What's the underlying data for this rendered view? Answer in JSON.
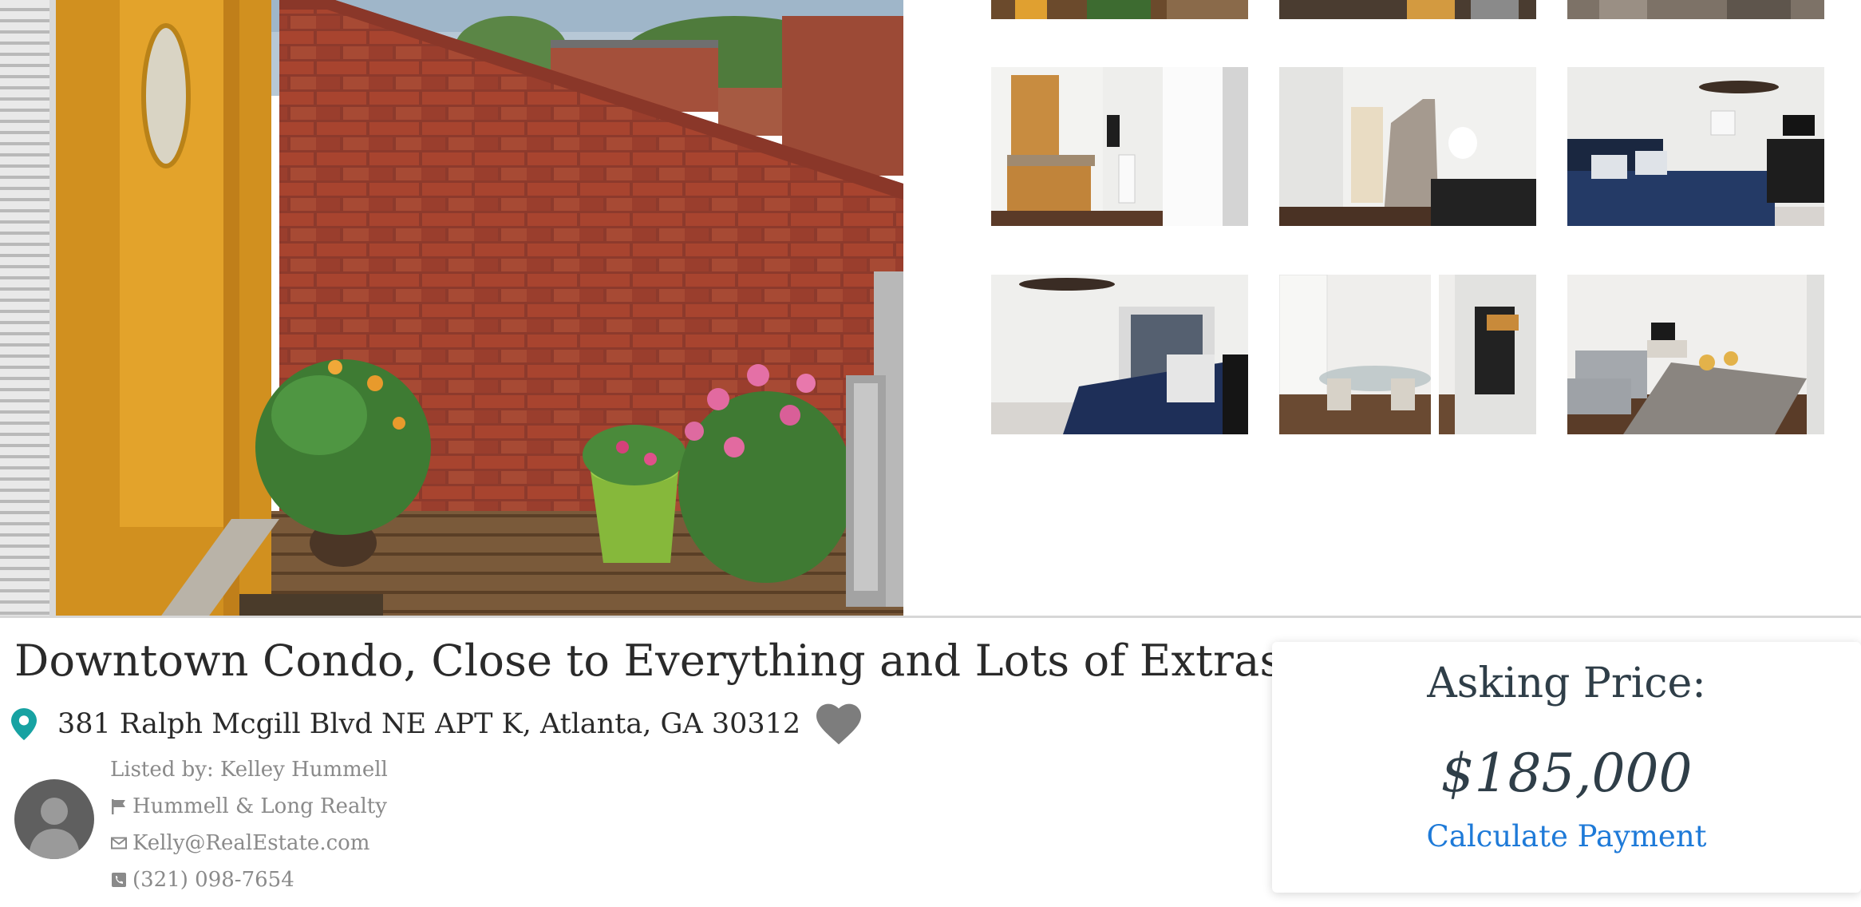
{
  "listing": {
    "title": "Downtown Condo, Close to Everything and Lots of Extras!",
    "address": "381 Ralph Mcgill Blvd NE APT K, Atlanta, GA 30312"
  },
  "agent": {
    "listed_by": "Listed by: Kelley Hummell",
    "company": "Hummell & Long Realty",
    "email": "Kelly@RealEstate.com",
    "phone": "(321) 098-7654"
  },
  "price_card": {
    "label": "Asking Price:",
    "price": "$185,000",
    "calculate_link": "Calculate Payment"
  },
  "gallery": {
    "thumbnails": [
      "top-cropped-1",
      "top-cropped-2",
      "top-cropped-3",
      "bathroom",
      "staircase",
      "bedroom-main",
      "bedroom-2",
      "dining",
      "living-room"
    ]
  },
  "colors": {
    "accent_teal": "#17a2a2",
    "link_blue": "#1e7ad8",
    "heading_dark": "#2f3e48",
    "muted_gray": "#8a8a8a"
  },
  "icons": [
    "map-pin-icon",
    "heart-icon",
    "flag-icon",
    "envelope-icon",
    "phone-icon",
    "avatar-person-icon"
  ]
}
